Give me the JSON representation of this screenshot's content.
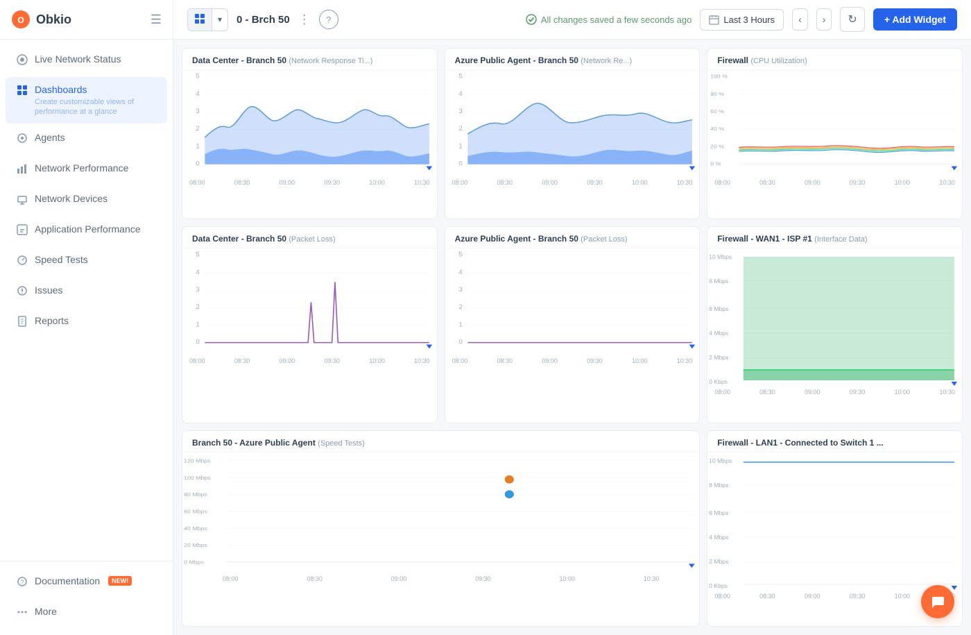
{
  "sidebar": {
    "logo": "Obkio",
    "items": [
      {
        "id": "live-network",
        "label": "Live Network Status",
        "icon": "●",
        "active": false
      },
      {
        "id": "dashboards",
        "label": "Dashboards",
        "sublabel": "Create customizable views of performance at a glance",
        "icon": "▦",
        "active": true
      },
      {
        "id": "agents",
        "label": "Agents",
        "icon": "◎",
        "active": false
      },
      {
        "id": "network-performance",
        "label": "Network Performance",
        "icon": "📊",
        "active": false
      },
      {
        "id": "network-devices",
        "label": "Network Devices",
        "icon": "🔗",
        "active": false
      },
      {
        "id": "application-performance",
        "label": "Application Performance",
        "icon": "◈",
        "active": false
      },
      {
        "id": "speed-tests",
        "label": "Speed Tests",
        "icon": "◎",
        "active": false
      },
      {
        "id": "issues",
        "label": "Issues",
        "icon": "◎",
        "active": false
      },
      {
        "id": "reports",
        "label": "Reports",
        "icon": "📋",
        "active": false
      }
    ],
    "bottom_items": [
      {
        "id": "documentation",
        "label": "Documentation",
        "badge": "NEW!",
        "icon": "◎"
      },
      {
        "id": "more",
        "label": "More",
        "icon": "···"
      }
    ]
  },
  "topbar": {
    "dashboard_name": "0 - Brch 50",
    "save_status": "All changes saved a few seconds ago",
    "time_range": "Last 3 Hours",
    "add_widget_label": "+ Add Widget"
  },
  "widgets": [
    {
      "id": "w1",
      "title": "Data Center - Branch 50",
      "subtitle": "(Network Response Ti...)",
      "type": "area_blue",
      "y_labels": [
        "5",
        "4",
        "3",
        "2",
        "1",
        "0"
      ],
      "x_labels": [
        "08:00",
        "08:30",
        "09:00",
        "09:30",
        "10:00",
        "10:30"
      ]
    },
    {
      "id": "w2",
      "title": "Azure Public Agent - Branch 50",
      "subtitle": "(Network Re...)",
      "type": "area_blue",
      "y_labels": [
        "5",
        "4",
        "3",
        "2",
        "1",
        "0"
      ],
      "x_labels": [
        "08:00",
        "08:30",
        "09:00",
        "09:30",
        "10:00",
        "10:30"
      ]
    },
    {
      "id": "w3",
      "title": "Firewall",
      "subtitle": "(CPU Utilization)",
      "type": "multiline",
      "y_labels": [
        "100 %",
        "80 %",
        "60 %",
        "40 %",
        "20 %",
        "0 %"
      ],
      "x_labels": [
        "08:00",
        "08:30",
        "09:00",
        "09:30",
        "10:00",
        "10:30"
      ]
    },
    {
      "id": "w4",
      "title": "Data Center - Branch 50",
      "subtitle": "(Packet Loss)",
      "type": "packet_loss",
      "y_labels": [
        "5",
        "4",
        "3",
        "2",
        "1",
        "0"
      ],
      "x_labels": [
        "08:00",
        "08:30",
        "09:00",
        "09:30",
        "10:00",
        "10:30"
      ]
    },
    {
      "id": "w5",
      "title": "Azure Public Agent - Branch 50",
      "subtitle": "(Packet Loss)",
      "type": "packet_loss_flat",
      "y_labels": [
        "5",
        "4",
        "3",
        "2",
        "1",
        "0"
      ],
      "x_labels": [
        "08:00",
        "08:30",
        "09:00",
        "09:30",
        "10:00",
        "10:30"
      ]
    },
    {
      "id": "w6",
      "title": "Firewall - WAN1 - ISP #1",
      "subtitle": "(Interface Data)",
      "type": "area_green",
      "y_labels": [
        "10 Mbps",
        "8 Mbps",
        "6 Mbps",
        "4 Mbps",
        "2 Mbps",
        "0 Kbps"
      ],
      "x_labels": [
        "08:00",
        "08:30",
        "09:00",
        "09:30",
        "10:00",
        "10:30"
      ]
    },
    {
      "id": "w7",
      "title": "Branch 50 - Azure Public Agent",
      "subtitle": "(Speed Tests)",
      "type": "speed_test",
      "y_labels": [
        "120 Mbps",
        "100 Mbps",
        "80 Mbps",
        "60 Mbps",
        "40 Mbps",
        "20 Mbps",
        "0 Mbps"
      ],
      "x_labels": [
        "08:00",
        "08:30",
        "09:00",
        "09:30",
        "10:00",
        "10:30"
      ]
    },
    {
      "id": "w8",
      "title": "Firewall - LAN1 - Connected to Switch 1 ...",
      "subtitle": "",
      "type": "area_flat_blue",
      "y_labels": [
        "10 Mbps",
        "8 Mbps",
        "6 Mbps",
        "4 Mbps",
        "2 Mbps",
        "0 Kbps"
      ],
      "x_labels": [
        "08:00",
        "08:30",
        "09:00",
        "09:30",
        "10:00",
        "10:30"
      ]
    }
  ]
}
